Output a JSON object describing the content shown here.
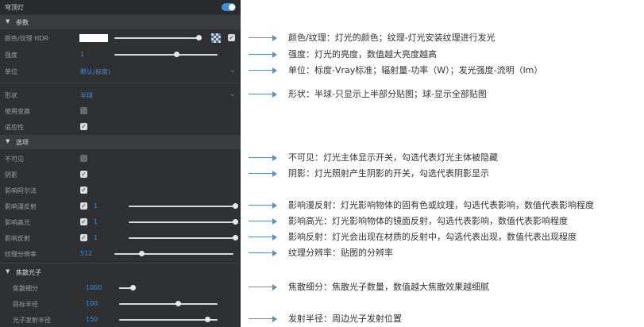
{
  "panel": {
    "title": "穹顶灯",
    "enabled": true,
    "sections": {
      "params": "参数",
      "options": "选项",
      "caustics": "焦散光子"
    },
    "rows": {
      "color": {
        "label": "颜色/纹理 HDR",
        "slider": 0.97
      },
      "intensity": {
        "label": "强度",
        "value": "1",
        "slider": 0.6
      },
      "unit": {
        "label": "单位",
        "value": "默认(标度)"
      },
      "shape": {
        "label": "形状",
        "value": "半球"
      },
      "use_transform": {
        "label": "使用变换",
        "checked": false
      },
      "adaptive": {
        "label": "适应性",
        "checked": true
      },
      "invisible": {
        "label": "不可见",
        "checked": false
      },
      "shadow": {
        "label": "阴影",
        "checked": true
      },
      "affect_alpha": {
        "label": "影响阿尔法",
        "checked": true
      },
      "affect_diffuse": {
        "label": "影响漫反射",
        "checked": true,
        "value": "1",
        "slider": 1.0
      },
      "affect_specular": {
        "label": "影响高光",
        "checked": true,
        "value": "1",
        "slider": 1.0
      },
      "affect_reflection": {
        "label": "影响反射",
        "checked": true,
        "value": "1",
        "slider": 1.0
      },
      "tex_res": {
        "label": "纹理分辨率",
        "value": "512",
        "slider": 0.23
      },
      "caustic_subdiv": {
        "label": "焦散细分",
        "value": "1000",
        "slider": 0.12
      },
      "target_radius": {
        "label": "目标半径",
        "value": "100",
        "slider": 0.6
      },
      "emit_radius": {
        "label": "光子发射半径",
        "value": "150",
        "slider": 0.9
      }
    }
  },
  "annotations": [
    "颜色/纹理：灯光的颜色；纹理-灯光安装纹理进行发光",
    "强度：灯光的亮度，数值越大亮度越高",
    "单位：标度-Vray标准；辐射量-功率（W）；发光强度-流明（lm）",
    "形状：半球-只显示上半部分贴图；球-显示全部贴图",
    "不可见：灯光主体显示开关，勾选代表灯光主体被隐藏",
    "阴影：灯光照射产生阴影的开关，勾选代表阴影显示",
    "影响漫反射：灯光影响物体的固有色或纹理，勾选代表影响，数值代表影响程度",
    "影响高光：灯光影响物体的镜面反射，勾选代表影响，数值代表影响程度",
    "影响反射：灯光会出现在材质的反射中，勾选代表出现，数值代表出现程度",
    "纹理分辨率：贴图的分辨率",
    "焦散细分：焦散光子数量，数值越大焦散效果越细腻",
    "发射半径：周边光子发射位置"
  ],
  "colors": {
    "accent": "#3f8fe0",
    "panel_bg": "#2f3032",
    "arrow": "#5a8fd0"
  },
  "icons": {
    "checker": "checkerboard-icon",
    "dropdown": "chevron-down-icon",
    "triangle": "triangle-down-icon"
  }
}
